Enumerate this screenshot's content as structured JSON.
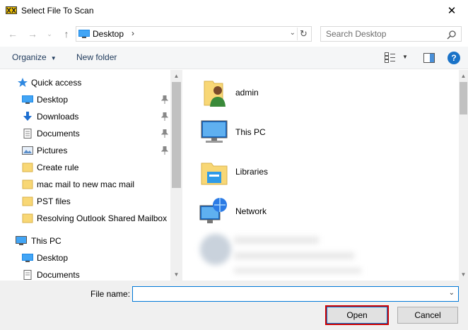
{
  "window": {
    "title": "Select File To Scan"
  },
  "address": {
    "location": "Desktop"
  },
  "search": {
    "placeholder": "Search Desktop"
  },
  "toolbar": {
    "organize_label": "Organize",
    "new_folder_label": "New folder"
  },
  "nav": {
    "quick_access_label": "Quick access",
    "items": [
      {
        "label": "Desktop",
        "icon": "desktop-icon",
        "pinned": true
      },
      {
        "label": "Downloads",
        "icon": "download-icon",
        "pinned": true
      },
      {
        "label": "Documents",
        "icon": "documents-icon",
        "pinned": true
      },
      {
        "label": "Pictures",
        "icon": "pictures-icon",
        "pinned": true
      },
      {
        "label": "Create rule",
        "icon": "folder-icon",
        "pinned": false
      },
      {
        "label": "mac mail to new mac mail",
        "icon": "folder-icon",
        "pinned": false
      },
      {
        "label": "PST files",
        "icon": "folder-icon",
        "pinned": false
      },
      {
        "label": "Resolving Outlook Shared Mailbox r",
        "icon": "folder-icon",
        "pinned": false
      }
    ],
    "this_pc_label": "This PC",
    "this_pc_items": [
      {
        "label": "Desktop",
        "icon": "desktop-icon"
      },
      {
        "label": "Documents",
        "icon": "documents-icon"
      }
    ]
  },
  "content": {
    "items": [
      {
        "label": "admin",
        "icon": "user-folder-icon"
      },
      {
        "label": "This PC",
        "icon": "computer-icon"
      },
      {
        "label": "Libraries",
        "icon": "libraries-icon"
      },
      {
        "label": "Network",
        "icon": "network-icon"
      }
    ]
  },
  "footer": {
    "file_name_label": "File name:",
    "file_name_value": "",
    "open_label": "Open",
    "cancel_label": "Cancel"
  },
  "colors": {
    "accent": "#0078d7",
    "highlight": "#d00000",
    "folder": "#f8d775"
  }
}
